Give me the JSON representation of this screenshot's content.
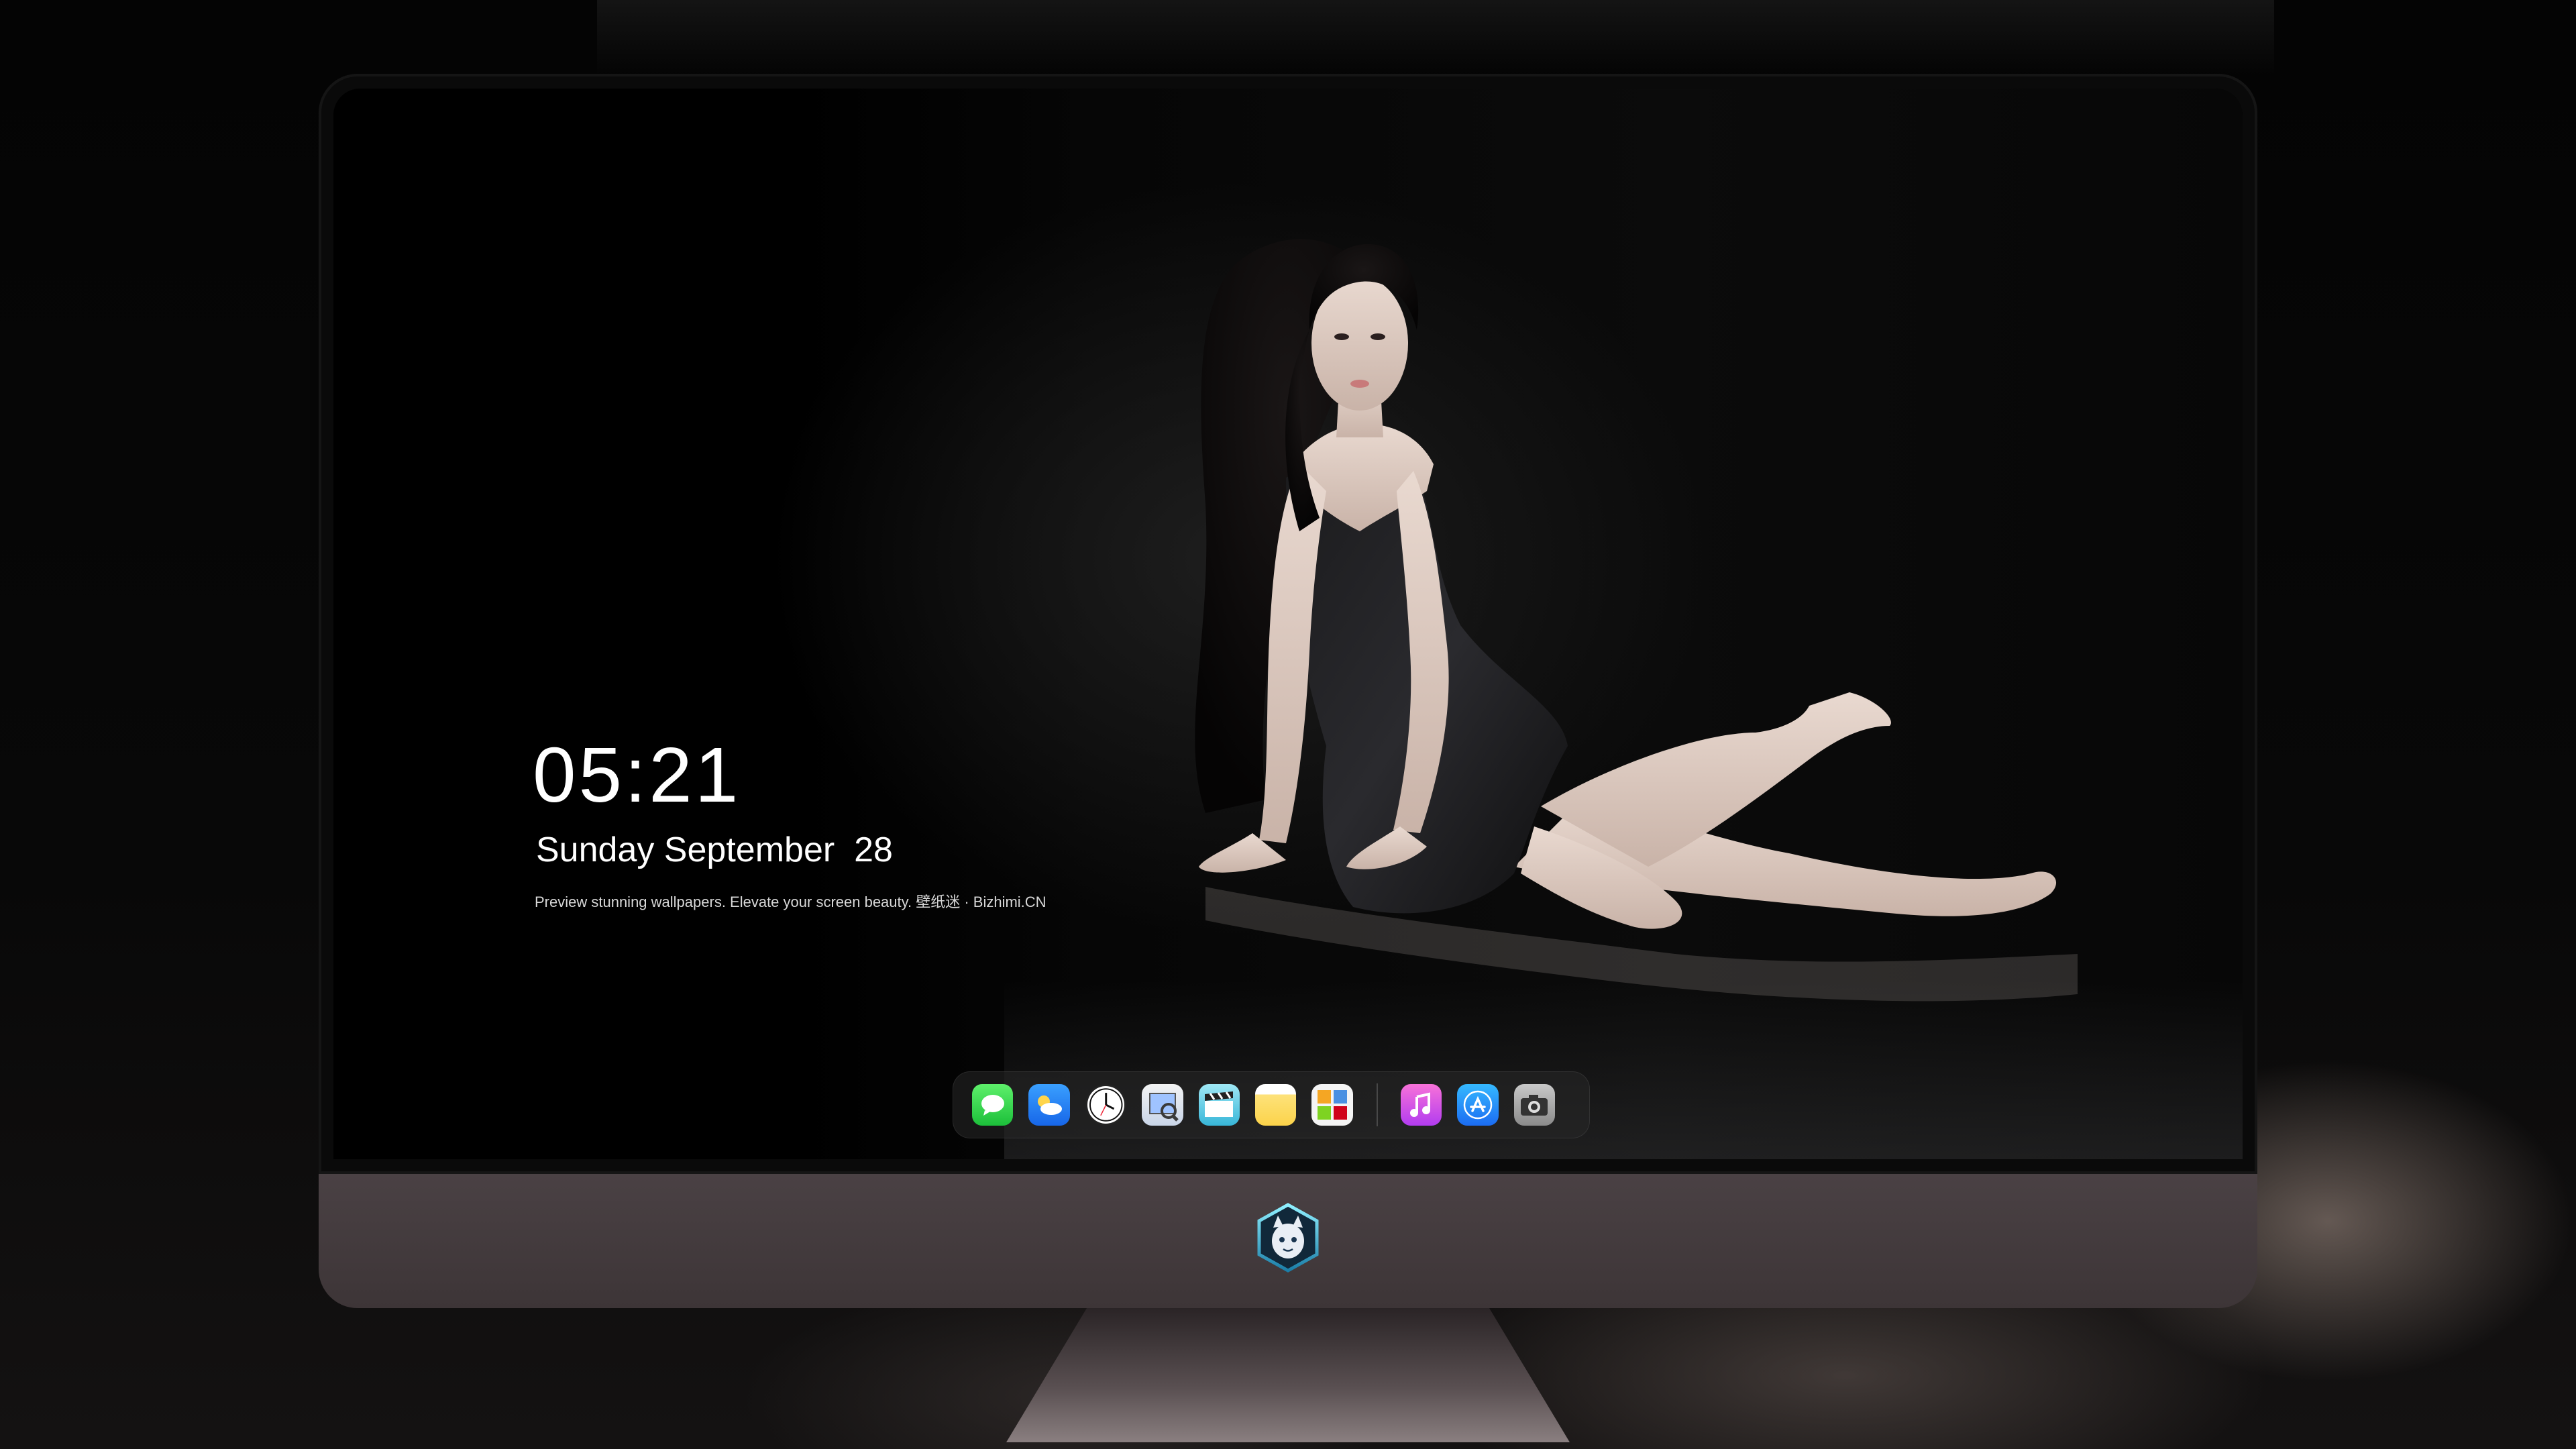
{
  "lock_screen": {
    "time": "05:21",
    "date": "Sunday September  28",
    "tagline": "Preview stunning wallpapers. Elevate your screen beauty. 壁纸迷 · Bizhimi.CN"
  },
  "dock": {
    "apps": [
      {
        "name": "Messages",
        "icon": "messages-icon"
      },
      {
        "name": "Weather",
        "icon": "weather-icon"
      },
      {
        "name": "Clock",
        "icon": "clock-icon"
      },
      {
        "name": "Preview",
        "icon": "preview-icon"
      },
      {
        "name": "Claquette",
        "icon": "clapperboard-icon"
      },
      {
        "name": "Notes",
        "icon": "notes-icon"
      },
      {
        "name": "Photo Collage",
        "icon": "photos-icon"
      },
      {
        "name": "Music",
        "icon": "music-icon"
      },
      {
        "name": "App Store",
        "icon": "app-store-icon"
      },
      {
        "name": "Camera",
        "icon": "camera-icon"
      }
    ]
  },
  "colors": {
    "chin": "#4a4144",
    "bezel": "#0a0a0a",
    "background": "#000000"
  }
}
